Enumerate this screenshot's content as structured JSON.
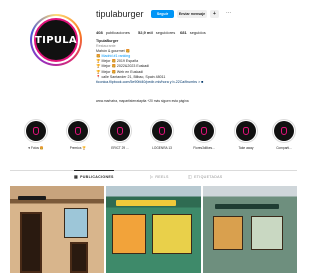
{
  "profile": {
    "username": "tipulaburger",
    "avatar_text": "TIPULA",
    "follow_label": "Seguir",
    "message_label": "Enviar mensaje",
    "suggest_label": "+",
    "more_label": "···"
  },
  "stats": [
    {
      "count": "408",
      "label": "publicaciones"
    },
    {
      "count": "52,9 mil",
      "label": "seguidores"
    },
    {
      "count": "681",
      "label": "seguidos"
    }
  ],
  "bio": {
    "name": "TipulaBurger",
    "category": "Restaurante",
    "lines": [
      "Mahón & gourmet 🍔",
      "🍔 Madrid #1 ranking",
      "🏆 Mejor 🍔 2019 España",
      "🏆 Mejor 🍔 2022&2023 Euskadi",
      "🏆 Mejor 🍔 Web en Euskadi",
      "📍 calle Santander 21, Bilbao, Spain 48011"
    ],
    "link": "ticonica.flipbook.com/5e90fd40/pedir-mb/hora y b-22Ca/thumbs > ■",
    "followed_by": "www.marhatra, mapartisterratapita +20 más siguen esta página"
  },
  "highlights": [
    {
      "label": "♥ Fotos 🍔"
    },
    {
      "label": "Premios 🏆"
    },
    {
      "label": "ERICT 29 ..."
    },
    {
      "label": "LOGENRA 13"
    },
    {
      "label": "Flores3dilkes..."
    },
    {
      "label": "Take away"
    },
    {
      "label": "Comparti..."
    }
  ],
  "tabs": [
    {
      "label": "PUBLICACIONES",
      "icon": "grid-icon"
    },
    {
      "label": "REELS",
      "icon": "reels-icon"
    },
    {
      "label": "ETIQUETADAS",
      "icon": "tagged-icon"
    }
  ],
  "colors": {
    "accent": "#0095f6",
    "brand_pink": "#e0137a"
  }
}
